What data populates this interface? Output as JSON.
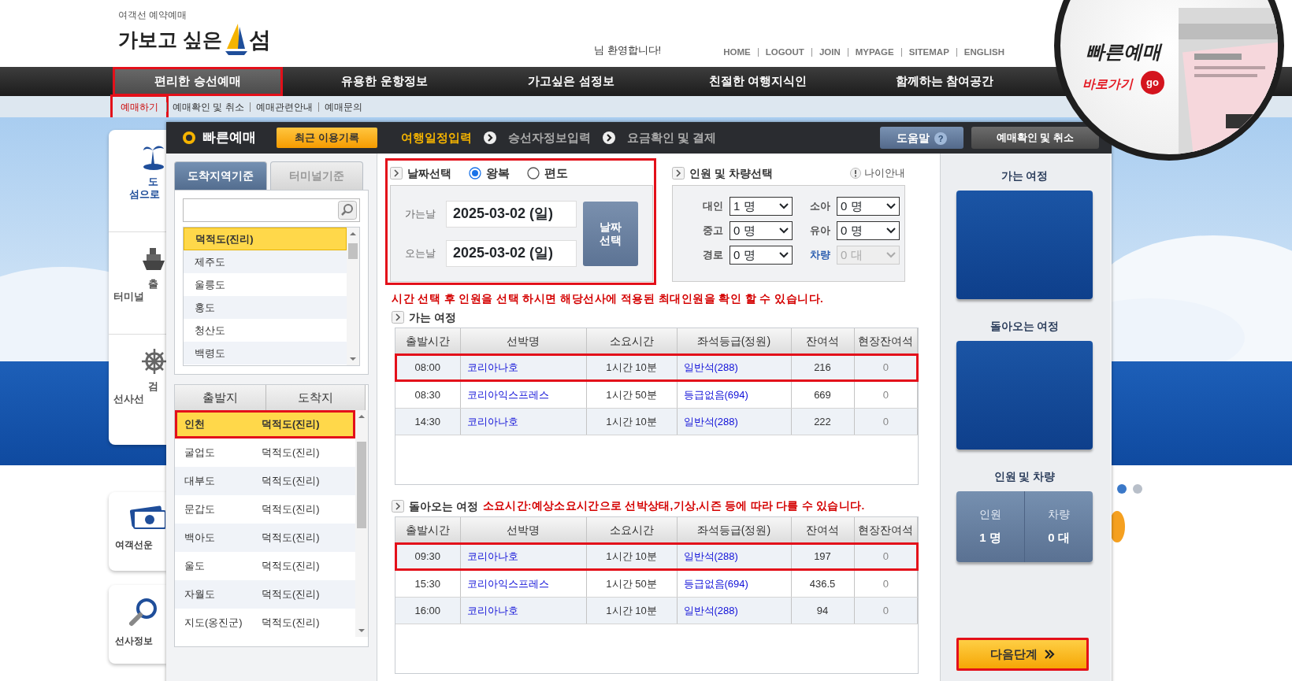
{
  "logo": {
    "tagline": "여객선 예약예매",
    "name": "가보고 싶은",
    "name_end": "섬"
  },
  "welcome": "님 환영합니다!",
  "top_links": [
    "HOME",
    "LOGOUT",
    "JOIN",
    "MYPAGE",
    "SITEMAP",
    "ENGLISH"
  ],
  "quick_badge": {
    "title": "빠른예매",
    "link": "바로가기",
    "go": "go"
  },
  "main_nav": [
    {
      "label": "편리한 승선예매",
      "selected": true,
      "highlighted": true
    },
    {
      "label": "유용한 운항정보",
      "selected": false,
      "highlighted": false
    },
    {
      "label": "가고싶은 섬정보",
      "selected": false,
      "highlighted": false
    },
    {
      "label": "친절한 여행지식인",
      "selected": false,
      "highlighted": false
    },
    {
      "label": "함께하는 참여공간",
      "selected": false,
      "highlighted": false
    }
  ],
  "sub_nav": [
    {
      "label": "예매하기",
      "selected": true,
      "highlighted": true
    },
    {
      "label": "예매확인 및 취소",
      "selected": false,
      "highlighted": false
    },
    {
      "label": "예매관련안내",
      "selected": false,
      "highlighted": false
    },
    {
      "label": "예매문의",
      "selected": false,
      "highlighted": false
    }
  ],
  "side_menu": [
    {
      "lines": [
        "도",
        "섬으로"
      ],
      "selected": true
    },
    {
      "lines": [
        "출",
        "터미널"
      ],
      "selected": false
    },
    {
      "lines": [
        "검",
        "선사선"
      ],
      "selected": false
    }
  ],
  "side_cards": [
    {
      "label": "여객선운"
    },
    {
      "label": "선사정보"
    }
  ],
  "slider_dots": [
    {
      "selected": true
    },
    {
      "selected": false
    }
  ],
  "panel": {
    "title": "빠른예매",
    "recent_button": "최근 이용기록",
    "steps": [
      {
        "label": "여행일정입력",
        "selected": true
      },
      {
        "label": "승선자정보입력",
        "selected": false
      },
      {
        "label": "요금확인 및 결제",
        "selected": false
      }
    ],
    "help_button": "도움말",
    "help_mark": "?",
    "check_button": "예매확인 및 취소"
  },
  "destination_tabs": [
    {
      "label": "도착지역기준",
      "selected": true
    },
    {
      "label": "터미널기준",
      "selected": false
    }
  ],
  "destinations": [
    {
      "label": "덕적도(진리)",
      "selected": true
    },
    {
      "label": "제주도",
      "selected": false
    },
    {
      "label": "울릉도",
      "selected": false
    },
    {
      "label": "홍도",
      "selected": false
    },
    {
      "label": "청산도",
      "selected": false
    },
    {
      "label": "백령도",
      "selected": false
    }
  ],
  "routes": {
    "columns": [
      "출발지",
      "도착지"
    ],
    "rows": [
      {
        "from": "인천",
        "to": "덕적도(진리)",
        "selected": true,
        "highlighted": true
      },
      {
        "from": "굴업도",
        "to": "덕적도(진리)",
        "selected": false,
        "highlighted": false
      },
      {
        "from": "대부도",
        "to": "덕적도(진리)",
        "selected": false,
        "highlighted": false
      },
      {
        "from": "문갑도",
        "to": "덕적도(진리)",
        "selected": false,
        "highlighted": false
      },
      {
        "from": "백아도",
        "to": "덕적도(진리)",
        "selected": false,
        "highlighted": false
      },
      {
        "from": "울도",
        "to": "덕적도(진리)",
        "selected": false,
        "highlighted": false
      },
      {
        "from": "자월도",
        "to": "덕적도(진리)",
        "selected": false,
        "highlighted": false
      },
      {
        "from": "지도(옹진군)",
        "to": "덕적도(진리)",
        "selected": false,
        "highlighted": false
      }
    ]
  },
  "date_select": {
    "title": "날짜선택",
    "highlighted": true,
    "trip_types": [
      {
        "label": "왕복",
        "selected": true
      },
      {
        "label": "편도",
        "selected": false
      }
    ],
    "depart_label": "가는날",
    "depart": "2025-03-02 (일)",
    "return_label": "오는날",
    "return": "2025-03-02 (일)",
    "button": "날짜 선택"
  },
  "passengers": {
    "title": "인원 및 차량선택",
    "age_info": "나이안내",
    "fields": [
      {
        "label": "대인",
        "value": "1 명",
        "kind": "person",
        "disabled": false
      },
      {
        "label": "소아",
        "value": "0 명",
        "kind": "person",
        "disabled": false
      },
      {
        "label": "중고",
        "value": "0 명",
        "kind": "person",
        "disabled": false
      },
      {
        "label": "유아",
        "value": "0 명",
        "kind": "person",
        "disabled": false
      },
      {
        "label": "경로",
        "value": "0 명",
        "kind": "person",
        "disabled": false
      },
      {
        "label": "차량",
        "value": "0 대",
        "kind": "vehicle",
        "disabled": true
      }
    ]
  },
  "notice": "시간 선택 후 인원을 선택 하시면 해당선사에 적용된 최대인원을 확인 할 수 있습니다.",
  "outbound": {
    "title": "가는 여정",
    "columns": [
      "출발시간",
      "선박명",
      "소요시간",
      "좌석등급(정원)",
      "잔여석",
      "현장잔여석"
    ],
    "rows": [
      {
        "cells": [
          "08:00",
          "코리아나호",
          "1시간 10분",
          "일반석(288)",
          "216",
          "0"
        ],
        "highlighted": true
      },
      {
        "cells": [
          "08:30",
          "코리아익스프레스",
          "1시간 50분",
          "등급없음(694)",
          "669",
          "0"
        ],
        "highlighted": false
      },
      {
        "cells": [
          "14:30",
          "코리아나호",
          "1시간 10분",
          "일반석(288)",
          "222",
          "0"
        ],
        "highlighted": false
      }
    ]
  },
  "return": {
    "title": "돌아오는 여정",
    "note": "소요시간:예상소요시간으로 선박상태,기상,시즌 등에 따라 다를 수 있습니다.",
    "columns": [
      "출발시간",
      "선박명",
      "소요시간",
      "좌석등급(정원)",
      "잔여석",
      "현장잔여석"
    ],
    "rows": [
      {
        "cells": [
          "09:30",
          "코리아나호",
          "1시간 10분",
          "일반석(288)",
          "197",
          "0"
        ],
        "highlighted": true
      },
      {
        "cells": [
          "15:30",
          "코리아익스프레스",
          "1시간 50분",
          "등급없음(694)",
          "436.5",
          "0"
        ],
        "highlighted": false
      },
      {
        "cells": [
          "16:00",
          "코리아나호",
          "1시간 10분",
          "일반석(288)",
          "94",
          "0"
        ],
        "highlighted": false
      }
    ]
  },
  "summary": {
    "outbound_title": "가는 여정",
    "return_title": "돌아오는 여정",
    "count_title": "인원 및 차량",
    "people_label": "인원",
    "people": "1 명",
    "vehicle_label": "차량",
    "vehicle": "0 대"
  },
  "next_button": {
    "label": "다음단계",
    "highlighted": true
  }
}
